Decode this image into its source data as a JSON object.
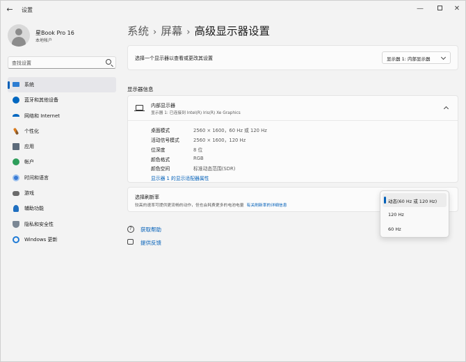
{
  "window": {
    "title": "设置",
    "back_glyph": "←",
    "min_glyph": "—",
    "close_glyph": "✕"
  },
  "profile": {
    "name": "星Book Pro 16",
    "account_type": "本地帐户"
  },
  "search": {
    "placeholder": "查找设置"
  },
  "sidebar": {
    "items": [
      {
        "label": "系统",
        "icon": "system-icon",
        "active": true
      },
      {
        "label": "蓝牙和其他设备",
        "icon": "bluetooth-icon"
      },
      {
        "label": "网络和 Internet",
        "icon": "wifi-icon"
      },
      {
        "label": "个性化",
        "icon": "brush-icon"
      },
      {
        "label": "应用",
        "icon": "apps-icon"
      },
      {
        "label": "帐户",
        "icon": "account-icon"
      },
      {
        "label": "时间和语言",
        "icon": "globe-clock-icon"
      },
      {
        "label": "游戏",
        "icon": "gamepad-icon"
      },
      {
        "label": "辅助功能",
        "icon": "accessibility-icon"
      },
      {
        "label": "隐私和安全性",
        "icon": "shield-icon"
      },
      {
        "label": "Windows 更新",
        "icon": "update-icon"
      }
    ]
  },
  "breadcrumb": {
    "items": [
      "系统",
      "屏幕",
      "高级显示器设置"
    ],
    "separator": "›"
  },
  "select_display": {
    "label": "选择一个显示器以查看或更改其设置",
    "selected": "显示器 1: 内部显示器"
  },
  "display_info": {
    "section_title": "显示器信息",
    "title": "内部显示器",
    "subtitle": "显示器 1: 已连接到 Intel(R) Iris(R) Xe Graphics",
    "rows": [
      {
        "key": "桌面模式",
        "value": "2560 × 1600，60 Hz 或 120 Hz"
      },
      {
        "key": "活动信号模式",
        "value": "2560 × 1600，120 Hz"
      },
      {
        "key": "位深度",
        "value": "8 位"
      },
      {
        "key": "颜色格式",
        "value": "RGB"
      },
      {
        "key": "颜色空间",
        "value": "标准动态范围(SDR)"
      }
    ],
    "adapter_link": "显示器 1 的显示适配器属性"
  },
  "refresh_rate": {
    "title": "选择刷新率",
    "description": "较高的速率可提供更流畅的动作，但也会耗费更多的电池电量",
    "link": "有关刷新率的详细信息",
    "options": [
      {
        "label": "动态(60 Hz 或 120 Hz)",
        "selected": true
      },
      {
        "label": "120 Hz",
        "selected": false
      },
      {
        "label": "60 Hz",
        "selected": false
      }
    ]
  },
  "help": {
    "get_help": "获取帮助",
    "feedback": "提供反馈"
  },
  "colors": {
    "accent": "#005fb8",
    "background": "#f3f3f3",
    "card": "#fbfbfb"
  }
}
